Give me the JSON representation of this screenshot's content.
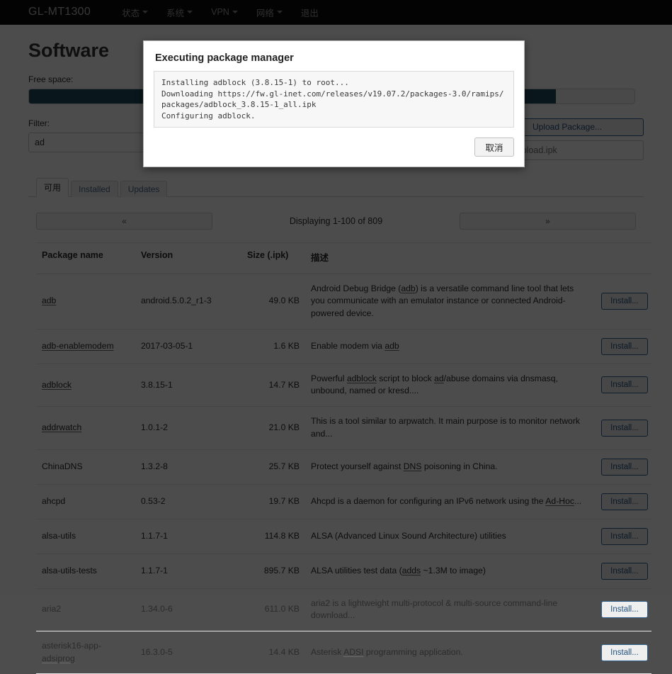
{
  "navbar": {
    "brand": "GL-MT1300",
    "items": [
      {
        "label": "状态",
        "has_caret": true
      },
      {
        "label": "系统",
        "has_caret": true
      },
      {
        "label": "VPN",
        "has_caret": true
      },
      {
        "label": "网络",
        "has_caret": true
      },
      {
        "label": "退出",
        "has_caret": false
      }
    ]
  },
  "page": {
    "title": "Software",
    "free_space_label": "Free space:",
    "free_space_percent": 87,
    "filter_label": "Filter:",
    "filter_value": "ad",
    "upload_button": "Upload Package...",
    "upload_path_placeholder": "/tmp/upload.ipk"
  },
  "tabs": [
    {
      "label": "可用",
      "active": true
    },
    {
      "label": "Installed",
      "active": false
    },
    {
      "label": "Updates",
      "active": false
    }
  ],
  "pager": {
    "prev": "«",
    "next": "»",
    "status": "Displaying 1-100 of 809"
  },
  "table": {
    "headers": {
      "name": "Package name",
      "version": "Version",
      "size": "Size (.ipk)",
      "description": "描述",
      "action": ""
    },
    "install_label": "Install...",
    "rows": [
      {
        "name": "adb",
        "version": "android.5.0.2_r1-3",
        "size": "49.0 KB",
        "description": "Android Debug Bridge (adb) is a versatile command line tool that lets you communicate with an emulator instance or connected Android-powered device."
      },
      {
        "name": "adb-enablemodem",
        "version": "2017-03-05-1",
        "size": "1.6 KB",
        "description": "Enable modem via adb"
      },
      {
        "name": "adblock",
        "version": "3.8.15-1",
        "size": "14.7 KB",
        "description": "Powerful adblock script to block ad/abuse domains via dnsmasq, unbound, named or kresd...."
      },
      {
        "name": "addrwatch",
        "version": "1.0.1-2",
        "size": "21.0 KB",
        "description": "This is a tool similar to arpwatch. It main purpose is to monitor network and..."
      },
      {
        "name": "ChinaDNS",
        "version": "1.3.2-8",
        "size": "25.7 KB",
        "description": "Protect yourself against DNS poisoning in China."
      },
      {
        "name": "ahcpd",
        "version": "0.53-2",
        "size": "19.7 KB",
        "description": "Ahcpd is a daemon for configuring an IPv6 network using the Ad-Hoc..."
      },
      {
        "name": "alsa-utils",
        "version": "1.1.7-1",
        "size": "114.8 KB",
        "description": "ALSA (Advanced Linux Sound Architecture) utilities"
      },
      {
        "name": "alsa-utils-tests",
        "version": "1.1.7-1",
        "size": "895.7 KB",
        "description": "ALSA utilities test data (adds ~1.3M to image)"
      },
      {
        "name": "aria2",
        "version": "1.34.0-6",
        "size": "611.0 KB",
        "description": "aria2 is a lightweight multi-protocol & multi-source command-line download..."
      },
      {
        "name": "asterisk16-app-adsiprog",
        "version": "16.3.0-5",
        "size": "14.4 KB",
        "description": "Asterisk ADSI programming application."
      }
    ]
  },
  "modal": {
    "title": "Executing package manager",
    "log": "Installing adblock (3.8.15-1) to root...\nDownloading https://fw.gl-inet.com/releases/v19.07.2/packages-3.0/ramips/packages/adblock_3.8.15-1_all.ipk\nConfiguring adblock.",
    "cancel_label": "取消"
  },
  "colors": {
    "navbar_bg": "#0d0d0d",
    "progress_fill": "#1f4a5c",
    "link_blue": "#24547f",
    "overlay": "rgba(0,0,0,0.70)"
  }
}
